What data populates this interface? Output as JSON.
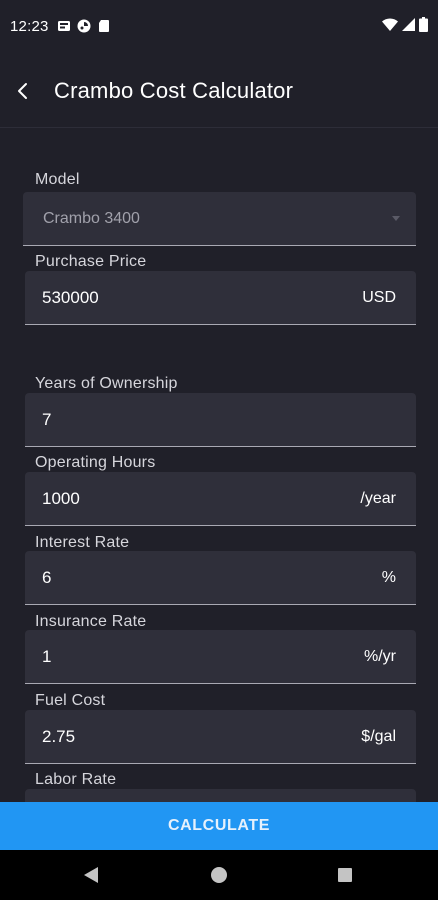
{
  "status_bar": {
    "time": "12:23",
    "left_icons": [
      "sim-card-icon",
      "cast-icon",
      "sd-card-icon"
    ],
    "right_icons": [
      "wifi-icon",
      "signal-icon",
      "battery-icon"
    ]
  },
  "app_bar": {
    "title": "Crambo Cost Calculator",
    "back_icon": "arrow-back-icon"
  },
  "form": {
    "model": {
      "label": "Model",
      "value": "Crambo 3400"
    },
    "purchase_price": {
      "label": "Purchase Price",
      "value": "530000",
      "suffix": "USD"
    },
    "years": {
      "label": "Years of Ownership",
      "value": "7"
    },
    "hours": {
      "label": "Operating Hours",
      "value": "1000",
      "suffix": "/year"
    },
    "interest": {
      "label": "Interest Rate",
      "value": "6",
      "suffix": "%"
    },
    "insurance": {
      "label": "Insurance Rate",
      "value": "1",
      "suffix": "%/yr"
    },
    "fuel": {
      "label": "Fuel Cost",
      "value": "2.75",
      "suffix": "$/gal"
    },
    "labor": {
      "label": "Labor Rate"
    }
  },
  "calculate_label": "CALCULATE",
  "colors": {
    "background": "#202029",
    "field_background": "#2f2f3a",
    "accent": "#2196f3",
    "nav_bar": "#000000"
  },
  "nav_bar": {
    "buttons": [
      "nav-back-icon",
      "nav-home-icon",
      "nav-recents-icon"
    ]
  }
}
